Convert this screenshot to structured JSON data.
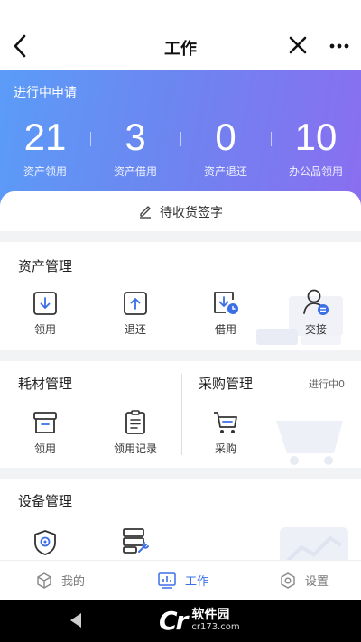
{
  "header": {
    "title": "工作"
  },
  "banner": {
    "label": "进行中申请",
    "stats": [
      {
        "value": "21",
        "caption": "资产领用"
      },
      {
        "value": "3",
        "caption": "资产借用"
      },
      {
        "value": "0",
        "caption": "资产退还"
      },
      {
        "value": "10",
        "caption": "办公品领用"
      }
    ]
  },
  "sign": {
    "label": "待收货签字"
  },
  "asset": {
    "title": "资产管理",
    "items": [
      {
        "label": "领用"
      },
      {
        "label": "退还"
      },
      {
        "label": "借用"
      },
      {
        "label": "交接"
      }
    ]
  },
  "consumable": {
    "title": "耗材管理",
    "items": [
      {
        "label": "领用"
      },
      {
        "label": "领用记录"
      }
    ]
  },
  "purchase": {
    "title": "采购管理",
    "status": "进行中0",
    "items": [
      {
        "label": "采购"
      }
    ]
  },
  "device": {
    "title": "设备管理"
  },
  "tabs": [
    {
      "label": "我的"
    },
    {
      "label": "工作"
    },
    {
      "label": "设置"
    }
  ],
  "watermark": {
    "name": "软件园",
    "url": "cr173.com"
  },
  "colors": {
    "accent": "#3b6fe8",
    "bannerStart": "#5b9cf8",
    "bannerEnd": "#8a6ef0"
  }
}
